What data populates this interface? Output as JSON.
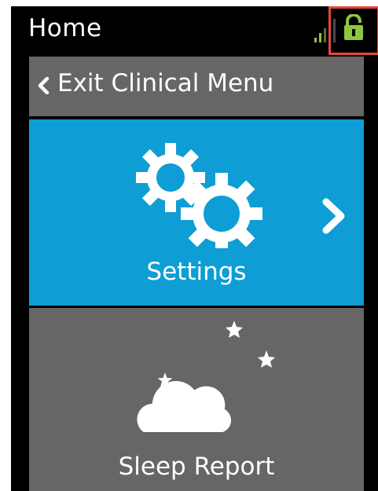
{
  "header": {
    "title": "Home",
    "signal_icon": "signal-strength-icon",
    "lock_icon": "unlocked-padlock-icon",
    "status_color": "#8dc63f",
    "highlight_color": "#e8463b"
  },
  "menu": {
    "exit": {
      "label": "Exit Clinical Menu",
      "icon": "chevron-left-icon"
    },
    "settings": {
      "label": "Settings",
      "icon": "gears-icon",
      "chevron_icon": "chevron-right-icon",
      "state": "selected",
      "color": "#0e9ed5"
    },
    "sleep_report": {
      "label": "Sleep Report",
      "icon": "moon-cloud-stars-icon",
      "color": "#666666"
    }
  }
}
